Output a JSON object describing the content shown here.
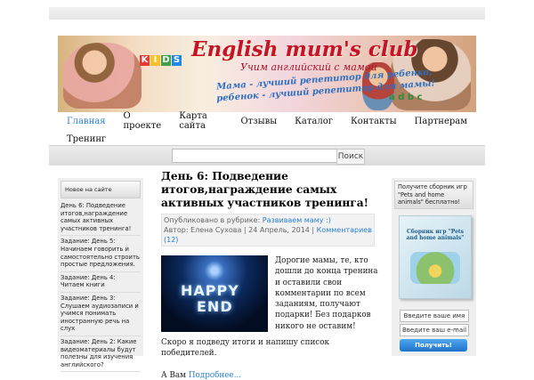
{
  "banner": {
    "title": "English mum's club",
    "subtitle": "Учим английский с мамой",
    "tagline1": "Мама - лучший репетитор для ребенка,",
    "tagline2": "ребенок - лучший репетитор для мамы!",
    "blocks": [
      "K",
      "I",
      "D",
      "S"
    ],
    "abc": "a  d  b  c"
  },
  "nav": {
    "items": [
      "Главная",
      "О проекте",
      "Карта сайта",
      "Отзывы",
      "Каталог",
      "Контакты",
      "Партнерам",
      "Тренинг"
    ]
  },
  "search": {
    "button": "Поиск"
  },
  "sidebar_left": {
    "heading": "Новое на сайте",
    "items": [
      "День 6: Подведение итогов,награждение самых активных участников тренинга!",
      "Задание: День 5: Начинаем говорить и самостоятельно строить простые предложения.",
      "Задание: День 4: Читаем книги",
      "Задание: День 3: Слушаем аудиозаписи и учимся понимать иностранную речь на слух",
      "Задание: День 2: Какие видеоматериалы будут полезны для изучения английского?"
    ]
  },
  "post": {
    "title": "День 6: Подведение итогов,награждение самых активных участников тренинга!",
    "meta_prefix": "Опубликовано в рубрике:",
    "meta_category": "Развиваем маму :)",
    "meta_author": "Автор: Елена Сухова | 24 Апрель, 2014 |",
    "meta_comments": "Комментариев (12)",
    "image_words": [
      "HAPPY",
      "END"
    ],
    "intro": "Дорогие мамы, те, кто дошли до конца тренина и оставили свои комментарии по всем заданиям, получают подарки! Без подарков никого не оставим!",
    "paragraph": "Скоро я подведу итоги и напишу список победителей.",
    "paragraph2_start": "А Вам ",
    "paragraph2_link": "Подробнее..."
  },
  "sidebar_right": {
    "heading": "Получите сборник игр \"Pets and home animals\" бесплатно!",
    "book_title": "Сборник игр \"Pets and home animals\"",
    "name_field": "Введите ваше имя",
    "email_field": "Введите ваш e-mail",
    "submit": "Получить!"
  }
}
